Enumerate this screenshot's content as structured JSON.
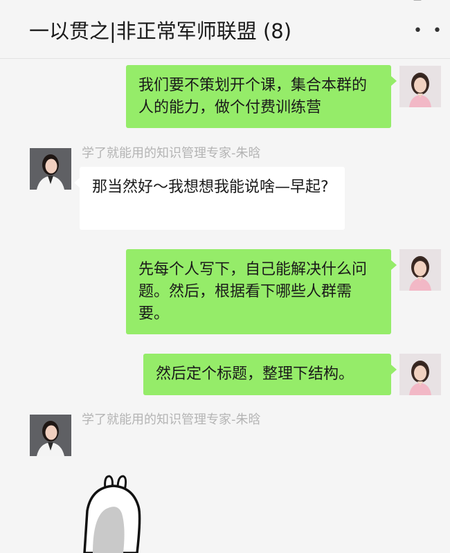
{
  "header": {
    "title": "一以贯之|非正常军师联盟 (8)",
    "more_icon": "more-icon",
    "pin_icon": "pin-icon",
    "minimize_icon": "minimize-icon",
    "maximize_icon": "maximize-icon"
  },
  "messages": [
    {
      "sender": "me",
      "text": "我们要不策划开个课，集合本群的人的能力，做个付费训练营"
    },
    {
      "sender": "other",
      "name": "学了就能用的知识管理专家-朱晗",
      "text": "那当然好～我想想我能说啥—早起?"
    },
    {
      "sender": "me",
      "text": "先每个人写下，自己能解决什么问题。然后，根据看下哪些人群需要。"
    },
    {
      "sender": "me",
      "text": "然后定个标题，整理下结构。"
    },
    {
      "sender": "other",
      "name": "学了就能用的知识管理专家-朱晗",
      "sticker": "bunny-sticker"
    }
  ],
  "colors": {
    "my_bubble": "#95ec69",
    "their_bubble": "#ffffff",
    "background": "#f5f5f5",
    "name_text": "#b4b4b4"
  }
}
